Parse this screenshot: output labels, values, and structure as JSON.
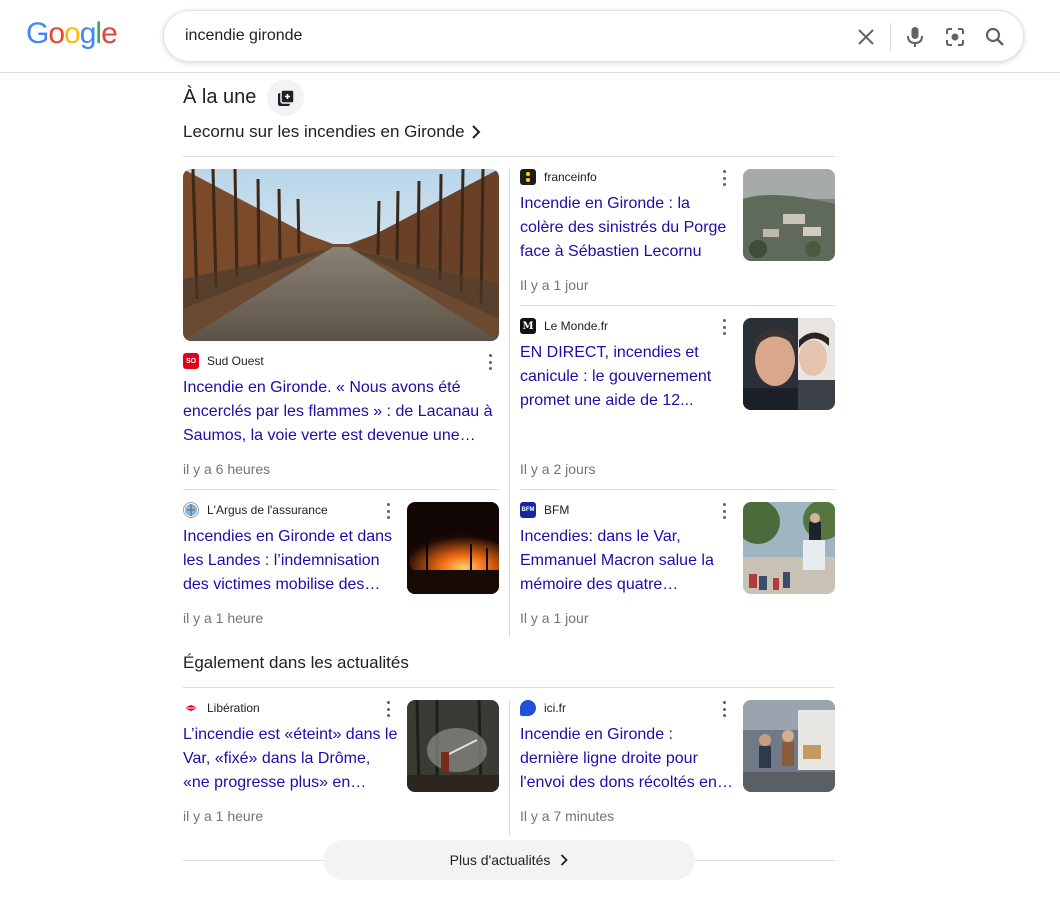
{
  "header": {
    "logo_text": "Google",
    "search_query": "incendie gironde"
  },
  "top_stories": {
    "title": "À la une",
    "story_link": "Lecornu sur les incendies en Gironde",
    "articles": [
      {
        "source": "Sud Ouest",
        "headline": "Incendie en Gironde. « Nous avons été encerclés par les flammes » : de Lacanau à Saumos, la voie verte est devenue une…",
        "time": "il y a 6 heures"
      },
      {
        "source": "franceinfo",
        "headline": "Incendie en Gironde : la colère des sinistrés du Porge face à Sébastien Lecornu",
        "time": "Il y a 1 jour"
      },
      {
        "source": "Le Monde.fr",
        "headline": "EN DIRECT, incendies et canicule : le gouvernement promet une aide de 12...",
        "time": "Il y a 2 jours"
      },
      {
        "source": "L'Argus de l'assurance",
        "headline": "Incendies en Gironde et dans les Landes : l’indemnisation des victimes mobilise des…",
        "time": "il y a 1 heure"
      },
      {
        "source": "BFM",
        "headline": "Incendies: dans le Var, Emmanuel Macron salue la mémoire des quatre…",
        "time": "Il y a 1 jour"
      }
    ]
  },
  "also_in_news": {
    "title": "Également dans les actualités",
    "articles": [
      {
        "source": "Libération",
        "headline": "L’incendie est «éteint» dans le Var, «fixé» dans la Drôme, «ne progresse plus» en…",
        "time": "il y a 1 heure"
      },
      {
        "source": "ici.fr",
        "headline": "Incendie en Gironde : dernière ligne droite pour l'envoi des dons récoltés en…",
        "time": "Il y a 7 minutes"
      }
    ]
  },
  "more_button": "Plus d'actualités",
  "colors": {
    "link": "#1a0dab",
    "meta": "#70757a",
    "divider": "#dadce0"
  }
}
